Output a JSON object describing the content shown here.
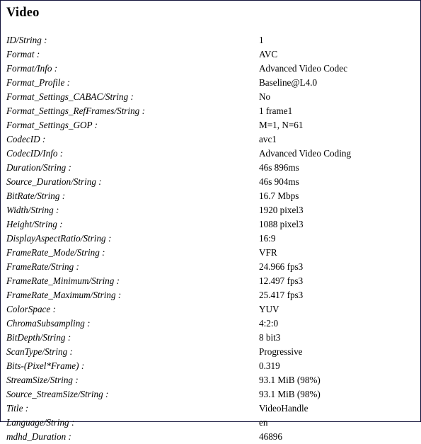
{
  "document": {
    "title": "Video",
    "section_heading": "Video",
    "border_color": "#12123a",
    "text_color": "#000000",
    "background_color": "#ffffff"
  },
  "properties": [
    {
      "label": "ID/String :",
      "value": "1"
    },
    {
      "label": "Format :",
      "value": "AVC"
    },
    {
      "label": "Format/Info :",
      "value": "Advanced Video Codec"
    },
    {
      "label": "Format_Profile :",
      "value": "Baseline@L4.0"
    },
    {
      "label": "Format_Settings_CABAC/String :",
      "value": "No"
    },
    {
      "label": "Format_Settings_RefFrames/String :",
      "value": "1 frame1"
    },
    {
      "label": "Format_Settings_GOP :",
      "value": "M=1, N=61"
    },
    {
      "label": "CodecID :",
      "value": "avc1"
    },
    {
      "label": "CodecID/Info :",
      "value": "Advanced Video Coding"
    },
    {
      "label": "Duration/String :",
      "value": "46s 896ms"
    },
    {
      "label": "Source_Duration/String :",
      "value": "46s 904ms"
    },
    {
      "label": "BitRate/String :",
      "value": "16.7 Mbps"
    },
    {
      "label": "Width/String :",
      "value": "1920 pixel3"
    },
    {
      "label": "Height/String :",
      "value": "1088 pixel3"
    },
    {
      "label": "DisplayAspectRatio/String :",
      "value": "16:9"
    },
    {
      "label": "FrameRate_Mode/String :",
      "value": "VFR"
    },
    {
      "label": "FrameRate/String :",
      "value": "24.966 fps3"
    },
    {
      "label": "FrameRate_Minimum/String :",
      "value": "12.497 fps3"
    },
    {
      "label": "FrameRate_Maximum/String :",
      "value": "25.417 fps3"
    },
    {
      "label": "ColorSpace :",
      "value": "YUV"
    },
    {
      "label": "ChromaSubsampling :",
      "value": "4:2:0"
    },
    {
      "label": "BitDepth/String :",
      "value": "8 bit3"
    },
    {
      "label": "ScanType/String :",
      "value": "Progressive"
    },
    {
      "label": "Bits-(Pixel*Frame) :",
      "value": "0.319"
    },
    {
      "label": "StreamSize/String :",
      "value": "93.1 MiB (98%)"
    },
    {
      "label": "Source_StreamSize/String :",
      "value": "93.1 MiB (98%)"
    },
    {
      "label": "Title :",
      "value": "VideoHandle"
    },
    {
      "label": "Language/String :",
      "value": "en"
    },
    {
      "label": "mdhd_Duration :",
      "value": "46896"
    }
  ]
}
